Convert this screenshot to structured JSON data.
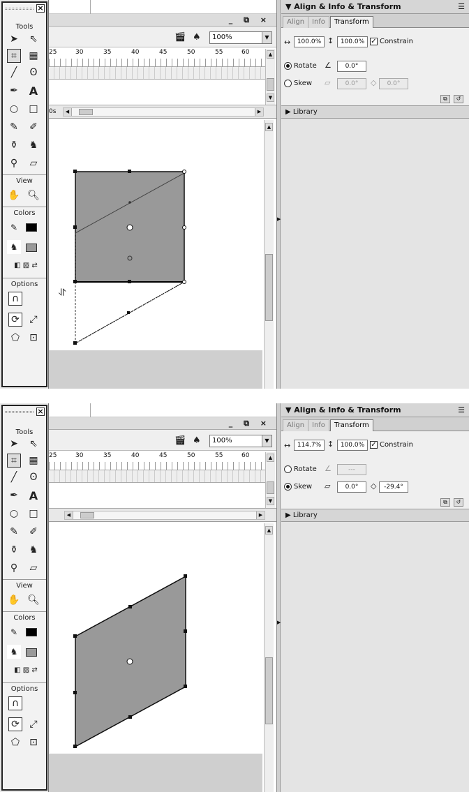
{
  "tools_panel": {
    "title": "Tools",
    "view_label": "View",
    "colors_label": "Colors",
    "options_label": "Options",
    "stroke_color": "#000000",
    "fill_color": "#999999"
  },
  "toolbar": {
    "zoom": "100%",
    "ruler_numbers": [
      "25",
      "30",
      "35",
      "40",
      "45",
      "50",
      "55",
      "60"
    ],
    "frame_label": "0s"
  },
  "panel": {
    "title": "Align & Info & Transform",
    "tabs": [
      "Align",
      "Info",
      "Transform"
    ],
    "active_tab": "Transform",
    "constrain_label": "Constrain",
    "rotate_label": "Rotate",
    "skew_label": "Skew",
    "library_label": "Library"
  },
  "screens": [
    {
      "width": "100.0%",
      "height": "100.0%",
      "constrain": true,
      "mode": "Rotate",
      "rotate_value": "0.0°",
      "skew_h": "0.0°",
      "skew_v": "0.0°",
      "shape_color": "#999999"
    },
    {
      "width": "114.7%",
      "height": "100.0%",
      "constrain": true,
      "mode": "Skew",
      "rotate_value": "---",
      "skew_h": "0.0°",
      "skew_v": "-29.4°",
      "shape_color": "#999999"
    }
  ]
}
